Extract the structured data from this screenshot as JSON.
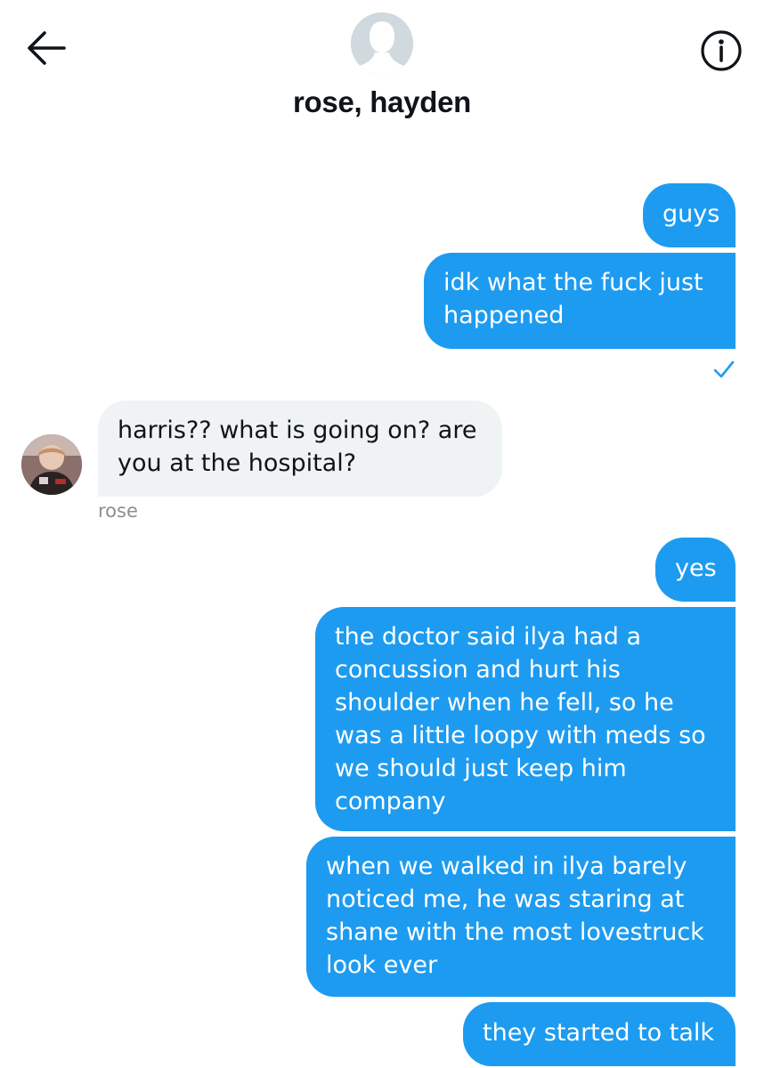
{
  "conversation": {
    "title": "rose, hayden",
    "back_icon": "arrow-left-icon",
    "info_icon": "info-circle-icon",
    "group_avatar_icon": "default-avatar-silhouette"
  },
  "messages": [
    {
      "direction": "outgoing",
      "text": "guys"
    },
    {
      "direction": "outgoing",
      "text": "idk what the fuck just happened",
      "status_icon": "checkmark-icon"
    },
    {
      "direction": "incoming",
      "sender": "rose",
      "text": "harris?? what is going on? are you at the hospital?"
    },
    {
      "direction": "outgoing",
      "text": "yes"
    },
    {
      "direction": "outgoing",
      "text": "the doctor said ilya had a concussion and hurt his shoulder when he fell, so he was a little loopy with meds so we should just keep him company"
    },
    {
      "direction": "outgoing",
      "text": "when we walked in ilya barely noticed me, he was staring at shane with the most lovestruck look ever"
    },
    {
      "direction": "outgoing",
      "text": "they started to talk"
    }
  ],
  "colors": {
    "outgoing_bubble": "#1d9bf0",
    "incoming_bubble": "#eff3f4",
    "check_color": "#1d9bf0",
    "sender_name": "#8a8f94"
  }
}
